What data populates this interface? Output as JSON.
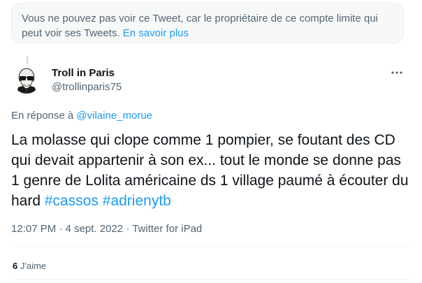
{
  "notice": {
    "text": "Vous ne pouvez pas voir ce Tweet, car le propriétaire de ce compte limite qui peut voir ses Tweets.",
    "link": "En savoir plus"
  },
  "tweet": {
    "author": {
      "name": "Troll in Paris",
      "handle": "@trollinparis75"
    },
    "more_icon": "more-horizontal-icon",
    "reply": {
      "prefix": "En réponse à",
      "handle": "@vilaine_morue"
    },
    "text_segments": [
      {
        "text": "La molasse qui clope comme 1 pompier, se foutant des CD qui devait appartenir à son ex... tout le monde se donne pas 1 genre de Lolita américaine ds 1 village paumé à écouter du hard ",
        "hashtag": false
      },
      {
        "text": "#cassos",
        "hashtag": true
      },
      {
        "text": " ",
        "hashtag": false
      },
      {
        "text": "#adrienytb",
        "hashtag": true
      }
    ],
    "meta": {
      "time": "12:07 PM",
      "separator": "·",
      "date": "4 sept. 2022",
      "source": "Twitter for iPad"
    },
    "likes": {
      "count": "6",
      "label": "J'aime"
    }
  },
  "colors": {
    "link": "#1d9bf0",
    "secondary": "#536471",
    "text": "#0f1419"
  }
}
